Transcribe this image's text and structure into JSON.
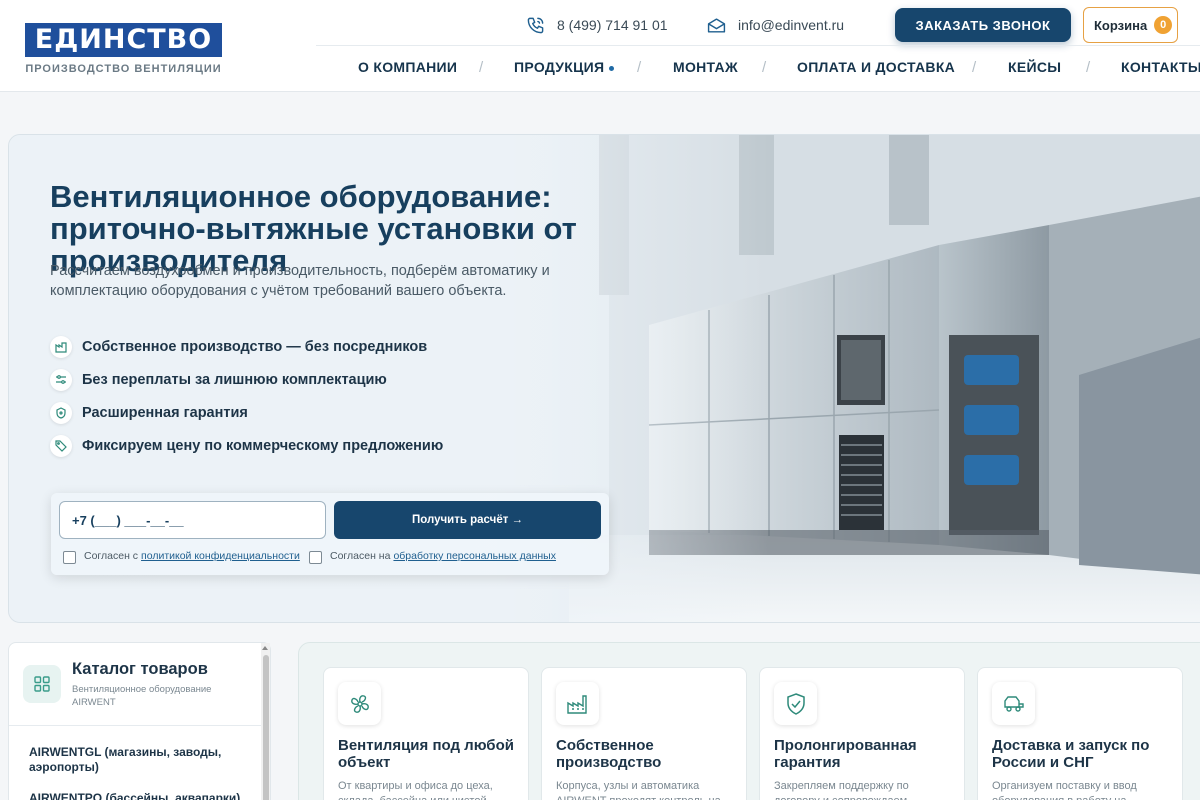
{
  "header": {
    "logo_text": "ЕДИНСТВО",
    "logo_sub": "ПРОИЗВОДСТВО ВЕНТИЛЯЦИИ",
    "phone": "8 (499) 714 91 01",
    "email": "info@edinvent.ru",
    "call_button": "ЗАКАЗАТЬ ЗВОНОК",
    "cart_label": "Корзина",
    "cart_count": "0",
    "accent_color": "#17466d",
    "cart_color": "#f0a233"
  },
  "nav": {
    "items": [
      {
        "label": "О КОМПАНИИ"
      },
      {
        "label": "ПРОДУКЦИЯ"
      },
      {
        "label": "МОНТАЖ"
      },
      {
        "label": "ОПЛАТА И ДОСТАВКА"
      },
      {
        "label": "КЕЙСЫ"
      },
      {
        "label": "КОНТАКТЫ"
      }
    ],
    "separator": "/"
  },
  "hero": {
    "title": "Вентиляционное оборудование: приточно-вытяжные установки от производителя",
    "subtitle": "Рассчитаем воздухообмен и производительность, подберём автоматику и комплектацию оборудования с учётом требований вашего объекта.",
    "features": [
      {
        "icon": "factory-icon",
        "label": "Собственное производство — без посредников"
      },
      {
        "icon": "sliders-icon",
        "label": "Без переплаты за лишнюю комплектацию"
      },
      {
        "icon": "shield-icon",
        "label": "Расширенная гарантия"
      },
      {
        "icon": "price-tag-icon",
        "label": "Фиксируем цену по коммерческому предложению"
      }
    ],
    "form": {
      "phone_value": "+7 (___) ___-__-__",
      "submit_label": "Получить расчёт →",
      "consent1_prefix": "Согласен с",
      "consent1_link": "политикой конфиденциальности",
      "consent2_prefix": "Согласен на",
      "consent2_link": "обработку персональных данных"
    }
  },
  "catalog": {
    "title": "Каталог товаров",
    "subtitle": "Вентиляционное оборудование AIRWENT",
    "items": [
      {
        "label": "AIRWENTGL (магазины, заводы, аэропорты)"
      },
      {
        "label": "AIRWENTPO (бассейны, аквапарки)"
      }
    ]
  },
  "benefits": [
    {
      "icon": "fan-icon",
      "title": "Вентиляция под любой объект",
      "text": "От квартиры и офиса до цеха, склада, бассейна или чистой"
    },
    {
      "icon": "factory-icon",
      "title": "Собственное производство",
      "text": "Корпуса, узлы и автоматика AIRWENT проходят контроль на"
    },
    {
      "icon": "shield-check-icon",
      "title": "Пролонгированная гарантия",
      "text": "Закрепляем поддержку по договору и сопровождаем"
    },
    {
      "icon": "truck-icon",
      "title": "Доставка и запуск по России и СНГ",
      "text": "Организуем поставку и ввод оборудования в работу на"
    }
  ]
}
